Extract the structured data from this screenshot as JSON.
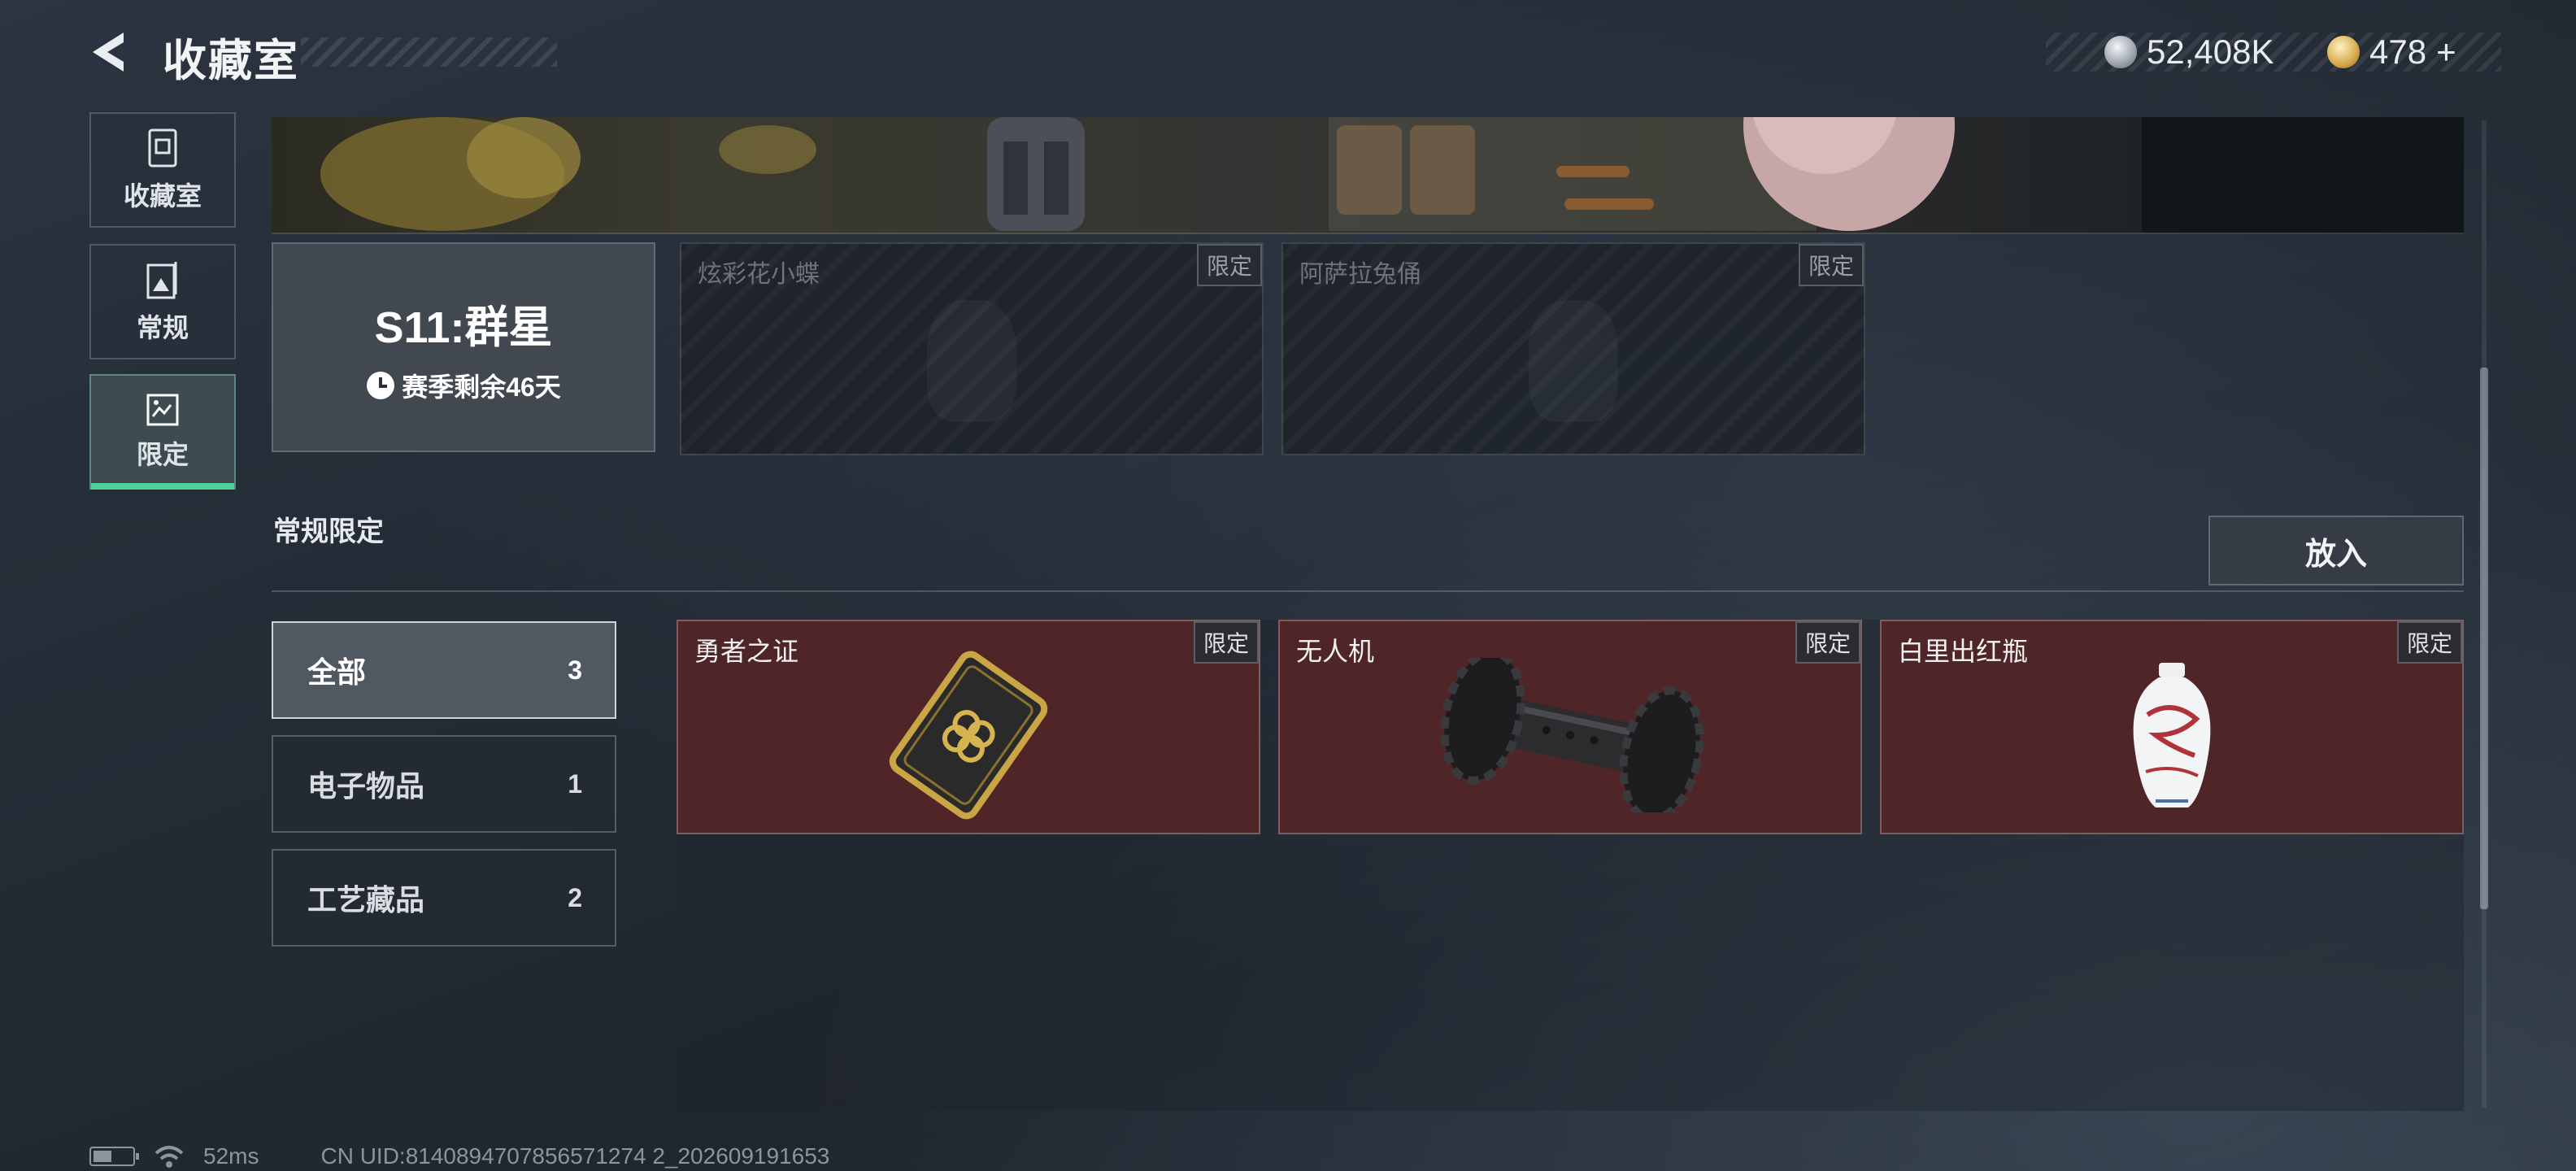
{
  "header": {
    "title": "收藏室",
    "currency": {
      "silver": "52,408K",
      "gold": "478",
      "gold_add": "+"
    }
  },
  "nav": {
    "items": [
      {
        "label": "收藏室",
        "icon": "collection-icon"
      },
      {
        "label": "常规",
        "icon": "photo-icon"
      },
      {
        "label": "限定",
        "icon": "image-edit-icon",
        "active": true
      }
    ]
  },
  "season": {
    "title": "S11:群星",
    "remaining": "赛季剩余46天"
  },
  "locked_items": [
    {
      "name": "炫彩花小蝶",
      "tag": "限定"
    },
    {
      "name": "阿萨拉兔俑",
      "tag": "限定"
    }
  ],
  "section": {
    "title": "常规限定",
    "put_in_label": "放入"
  },
  "filters": [
    {
      "label": "全部",
      "count": "3",
      "active": true
    },
    {
      "label": "电子物品",
      "count": "1"
    },
    {
      "label": "工艺藏品",
      "count": "2"
    }
  ],
  "items": [
    {
      "name": "勇者之证",
      "tag": "限定",
      "icon": "badge-card-icon"
    },
    {
      "name": "无人机",
      "tag": "限定",
      "icon": "drone-roller-icon"
    },
    {
      "name": "白里出红瓶",
      "tag": "限定",
      "icon": "porcelain-vase-icon"
    }
  ],
  "status": {
    "ping": "52ms",
    "uid": "CN UID:8140894707856571274 2_202609191653"
  },
  "colors": {
    "accent_green": "#4dd198",
    "item_card_bg": "#4f2528"
  }
}
